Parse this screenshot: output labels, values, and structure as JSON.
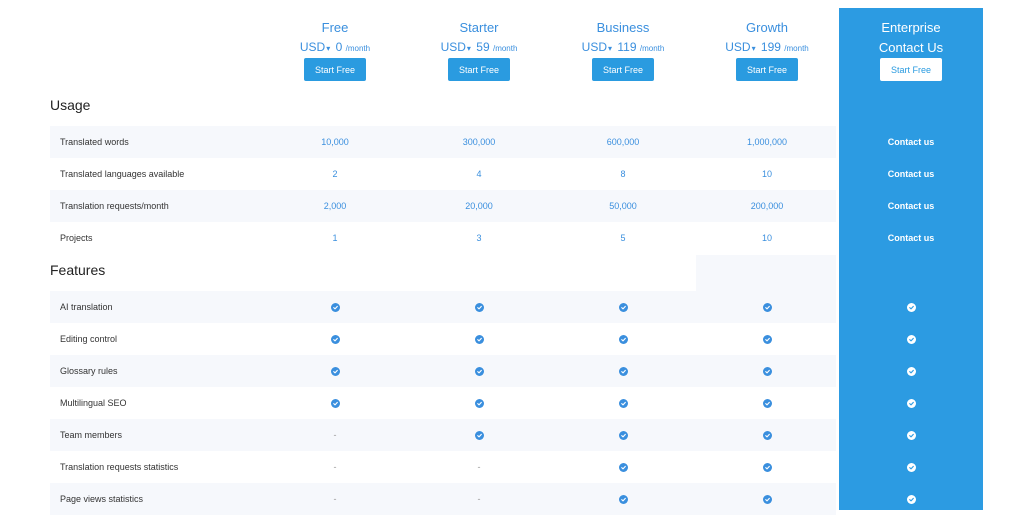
{
  "plans": [
    {
      "name": "Free",
      "currency": "USD",
      "price": "0",
      "per": "/month",
      "button": "Start Free"
    },
    {
      "name": "Starter",
      "currency": "USD",
      "price": "59",
      "per": "/month",
      "button": "Start Free"
    },
    {
      "name": "Business",
      "currency": "USD",
      "price": "119",
      "per": "/month",
      "button": "Start Free"
    },
    {
      "name": "Growth",
      "currency": "USD",
      "price": "199",
      "per": "/month",
      "button": "Start Free"
    }
  ],
  "enterprise": {
    "name": "Enterprise",
    "price_text": "Contact Us",
    "button": "Start Free",
    "cell_text": "Contact us"
  },
  "usage": {
    "title": "Usage",
    "rows": [
      {
        "label": "Translated words",
        "values": [
          "10,000",
          "300,000",
          "600,000",
          "1,000,000"
        ]
      },
      {
        "label": "Translated languages available",
        "values": [
          "2",
          "4",
          "8",
          "10"
        ]
      },
      {
        "label": "Translation requests/month",
        "values": [
          "2,000",
          "20,000",
          "50,000",
          "200,000"
        ]
      },
      {
        "label": "Projects",
        "values": [
          "1",
          "3",
          "5",
          "10"
        ]
      }
    ]
  },
  "features": {
    "title": "Features",
    "rows": [
      {
        "label": "AI translation",
        "values": [
          "check",
          "check",
          "check",
          "check"
        ]
      },
      {
        "label": "Editing control",
        "values": [
          "check",
          "check",
          "check",
          "check"
        ]
      },
      {
        "label": "Glossary rules",
        "values": [
          "check",
          "check",
          "check",
          "check"
        ]
      },
      {
        "label": "Multilingual SEO",
        "values": [
          "check",
          "check",
          "check",
          "check"
        ]
      },
      {
        "label": "Team members",
        "values": [
          "-",
          "check",
          "check",
          "check"
        ]
      },
      {
        "label": "Translation requests statistics",
        "values": [
          "-",
          "-",
          "check",
          "check"
        ]
      },
      {
        "label": "Page views statistics",
        "values": [
          "-",
          "-",
          "check",
          "check"
        ]
      }
    ]
  },
  "icons": {
    "check": "check-circle-icon",
    "chevron": "chevron-down-icon"
  },
  "colors": {
    "accent": "#2c9be2",
    "link": "#3a8fde",
    "row_shade": "#f6f8fc"
  }
}
